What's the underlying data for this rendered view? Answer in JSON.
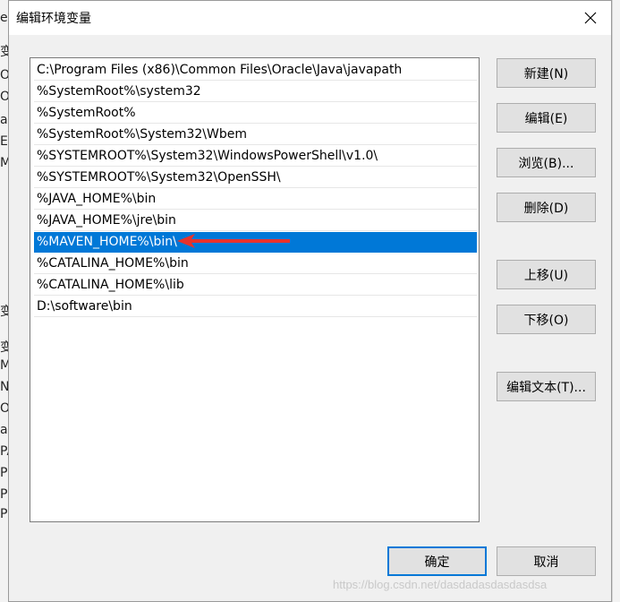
{
  "dialog": {
    "title": "编辑环境变量",
    "close_glyph": "✕"
  },
  "path_list": {
    "items": [
      "C:\\Program Files (x86)\\Common Files\\Oracle\\Java\\javapath",
      "%SystemRoot%\\system32",
      "%SystemRoot%",
      "%SystemRoot%\\System32\\Wbem",
      "%SYSTEMROOT%\\System32\\WindowsPowerShell\\v1.0\\",
      "%SYSTEMROOT%\\System32\\OpenSSH\\",
      "%JAVA_HOME%\\bin",
      "%JAVA_HOME%\\jre\\bin",
      "%MAVEN_HOME%\\bin\\",
      "%CATALINA_HOME%\\bin",
      "%CATALINA_HOME%\\lib",
      "D:\\software\\bin"
    ],
    "selected_index": 8
  },
  "buttons": {
    "new": "新建(N)",
    "edit": "编辑(E)",
    "browse": "浏览(B)...",
    "delete": "删除(D)",
    "move_up": "上移(U)",
    "move_down": "下移(O)",
    "edit_text": "编辑文本(T)...",
    "ok": "确定",
    "cancel": "取消"
  },
  "background_window": {
    "left_edge_glyphs": [
      "er",
      "变",
      "Or",
      "Or",
      "a",
      "E",
      "M",
      "",
      "",
      "",
      "",
      "",
      "",
      "",
      "",
      "变",
      "MA",
      "NU",
      "OS",
      "a",
      "PA",
      "PR",
      "PR",
      "P"
    ]
  },
  "watermark": "https://blog.csdn.net/dasdadasdasdasdsa",
  "colors": {
    "selection": "#0078d7",
    "arrow": "#e8322b",
    "default_button_border": "#0078d7"
  }
}
